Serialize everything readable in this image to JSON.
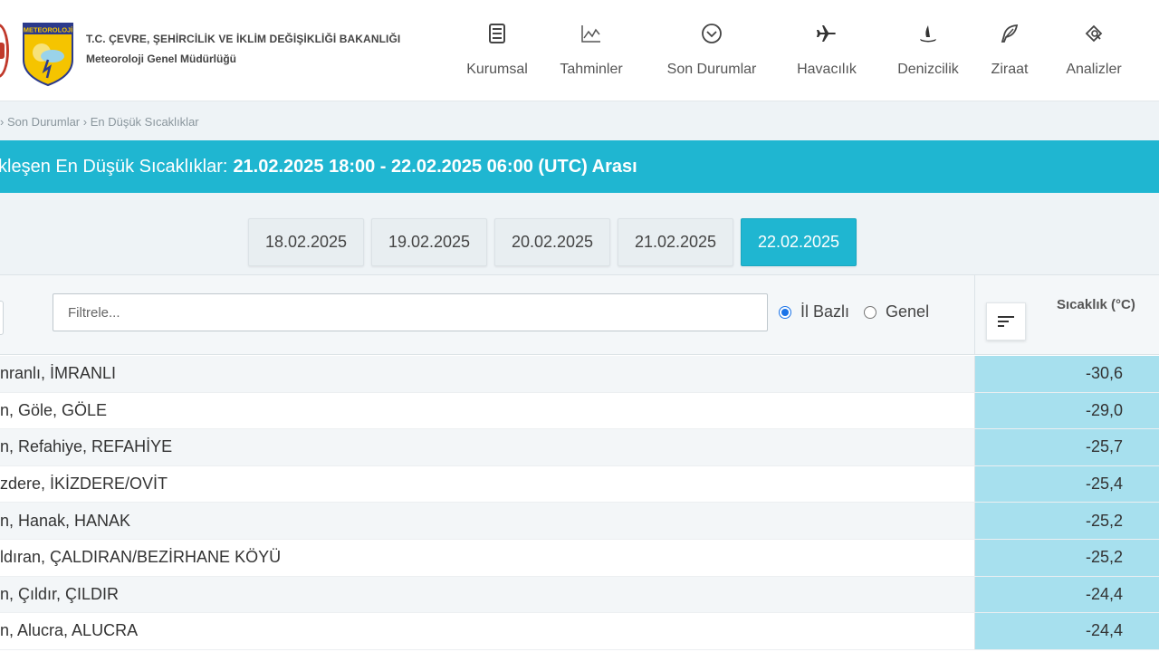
{
  "header": {
    "org_line1": "T.C. ÇEVRE, ŞEHİRCİLİK VE İKLİM DEĞİŞİKLİĞİ BAKANLIĞI",
    "org_line2": "Meteoroloji Genel Müdürlüğü",
    "logo_text": "METEOROLOJİ",
    "nav": [
      {
        "label": "Kurumsal",
        "icon": "document-icon"
      },
      {
        "label": "Tahminler",
        "icon": "chart-icon"
      },
      {
        "label": "Son Durumlar",
        "icon": "check-circle-icon"
      },
      {
        "label": "Havacılık",
        "icon": "airplane-icon"
      },
      {
        "label": "Denizcilik",
        "icon": "ship-icon"
      },
      {
        "label": "Ziraat",
        "icon": "leaf-icon"
      },
      {
        "label": "Analizler",
        "icon": "analysis-icon"
      }
    ]
  },
  "breadcrumb": "› Son Durumlar › En Düşük Sıcaklıklar",
  "banner": {
    "prefix": "kleşen En Düşük Sıcaklıklar:",
    "range": "21.02.2025 18:00 - 22.02.2025 06:00 (UTC) Arası"
  },
  "dates": [
    {
      "label": "18.02.2025",
      "active": false
    },
    {
      "label": "19.02.2025",
      "active": false
    },
    {
      "label": "20.02.2025",
      "active": false
    },
    {
      "label": "21.02.2025",
      "active": false
    },
    {
      "label": "22.02.2025",
      "active": true
    }
  ],
  "filter": {
    "placeholder": "Filtrele...",
    "value": ""
  },
  "radios": [
    {
      "label": "İl Bazlı",
      "checked": true
    },
    {
      "label": "Genel",
      "checked": false
    }
  ],
  "table": {
    "temp_header": "Sıcaklık (°C)",
    "rows": [
      {
        "location": "nranlı, İMRANLI",
        "temp": "-30,6"
      },
      {
        "location": "n, Göle, GÖLE",
        "temp": "-29,0"
      },
      {
        "location": "n, Refahiye, REFAHİYE",
        "temp": "-25,7"
      },
      {
        "location": "zdere, İKİZDERE/OVİT",
        "temp": "-25,4"
      },
      {
        "location": "n, Hanak, HANAK",
        "temp": "-25,2"
      },
      {
        "location": "ldıran, ÇALDIRAN/BEZİRHANE KÖYÜ",
        "temp": "-25,2"
      },
      {
        "location": "n, Çıldır, ÇILDIR",
        "temp": "-24,4"
      },
      {
        "location": "n, Alucra, ALUCRA",
        "temp": "-24,4"
      }
    ]
  },
  "colors": {
    "accent": "#1fb6d1",
    "temp_cell": "#a7e0ee"
  }
}
